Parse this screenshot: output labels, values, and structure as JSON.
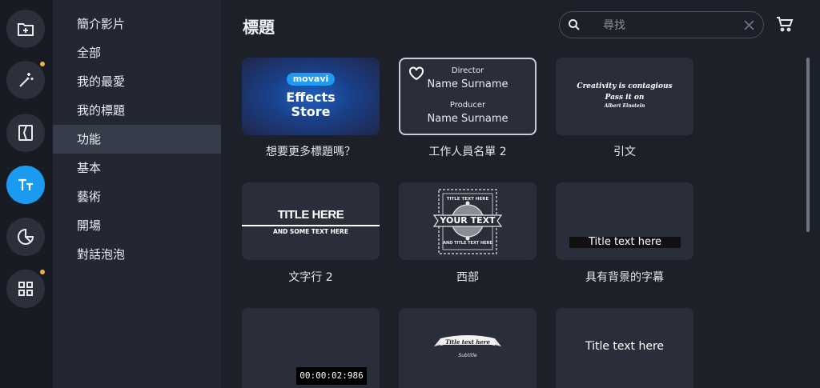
{
  "rail": {
    "items": [
      {
        "icon": "add-media-icon",
        "active": false,
        "badge": false
      },
      {
        "icon": "magic-wand-icon",
        "active": false,
        "badge": true
      },
      {
        "icon": "transitions-icon",
        "active": false,
        "badge": false
      },
      {
        "icon": "titles-icon",
        "active": true,
        "badge": false
      },
      {
        "icon": "stickers-icon",
        "active": false,
        "badge": false
      },
      {
        "icon": "more-tools-icon",
        "active": false,
        "badge": true
      }
    ]
  },
  "categories": {
    "items": [
      "簡介影片",
      "全部",
      "我的最愛",
      "我的標題",
      "功能",
      "基本",
      "藝術",
      "開場",
      "對話泡泡"
    ],
    "selected_index": 4
  },
  "main": {
    "title": "標題",
    "search": {
      "placeholder": "尋找",
      "value": ""
    }
  },
  "tiles": [
    {
      "caption": "想要更多標題嗎？",
      "pill": "movavi",
      "line1": "Effects",
      "line2": "Store"
    },
    {
      "caption": "工作人員名單 2",
      "role1": "Director",
      "name1": "Name Surname",
      "role2": "Producer",
      "name2": "Name Surname"
    },
    {
      "caption": "引文",
      "line1": "Creativity is contagious",
      "line2": "Pass it on",
      "author": "Albert Einstein"
    },
    {
      "caption": "文字行 2",
      "title": "TITLE HERE",
      "sub": "AND SOME TEXT HERE"
    },
    {
      "caption": "西部",
      "line_top": "TITLE TEXT HERE",
      "main": "YOUR TEXT",
      "line_bottom": "AND TITLE TEXT HERE"
    },
    {
      "caption": "具有背景的字幕",
      "text": "Title text here"
    },
    {
      "caption": "",
      "timecode": "00:00:02:986"
    },
    {
      "caption": "",
      "ribbon": "Title text here",
      "sub": "Subtitle"
    },
    {
      "caption": "",
      "text": "Title text here"
    }
  ],
  "colors": {
    "accent": "#1b9bf0",
    "badge": "#f2b33d",
    "sidebar_active": "#373c4a"
  }
}
